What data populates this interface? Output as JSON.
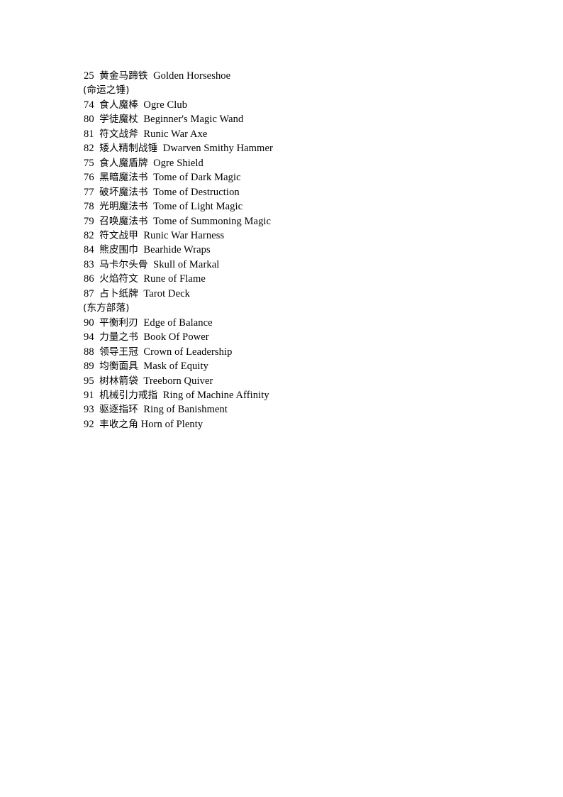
{
  "document": {
    "page_background": "#ffffff",
    "text_color": "#000000",
    "lines": [
      {
        "kind": "entry",
        "id": "25",
        "cn": "黄金马蹄铁",
        "en": "Golden Horseshoe",
        "gap": "wide"
      },
      {
        "kind": "section",
        "text": "(命运之锤)"
      },
      {
        "kind": "entry",
        "id": "74",
        "cn": "食人魔棒",
        "en": "Ogre Club",
        "gap": "wide"
      },
      {
        "kind": "entry",
        "id": "80",
        "cn": "学徒魔杖",
        "en": "Beginner's Magic Wand",
        "gap": "wide"
      },
      {
        "kind": "entry",
        "id": "81",
        "cn": "符文战斧",
        "en": "Runic War Axe",
        "gap": "wide"
      },
      {
        "kind": "entry",
        "id": "82",
        "cn": "矮人精制战锤",
        "en": "Dwarven Smithy Hammer",
        "gap": "wide"
      },
      {
        "kind": "entry",
        "id": "75",
        "cn": "食人魔盾牌",
        "en": "Ogre Shield",
        "gap": "wide"
      },
      {
        "kind": "entry",
        "id": "76",
        "cn": "黑暗魔法书",
        "en": "Tome of Dark Magic",
        "gap": "wide"
      },
      {
        "kind": "entry",
        "id": "77",
        "cn": "破坏魔法书",
        "en": "Tome of Destruction",
        "gap": "wide"
      },
      {
        "kind": "entry",
        "id": "78",
        "cn": "光明魔法书",
        "en": "Tome of Light Magic",
        "gap": "wide"
      },
      {
        "kind": "entry",
        "id": "79",
        "cn": "召唤魔法书",
        "en": "Tome of Summoning Magic",
        "gap": "wide"
      },
      {
        "kind": "entry",
        "id": "82",
        "cn": "符文战甲",
        "en": "Runic War Harness",
        "gap": "wide"
      },
      {
        "kind": "entry",
        "id": "84",
        "cn": "熊皮围巾",
        "en": "Bearhide Wraps",
        "gap": "wide"
      },
      {
        "kind": "entry",
        "id": "83",
        "cn": "马卡尔头骨",
        "en": "Skull of Markal",
        "gap": "wide"
      },
      {
        "kind": "entry",
        "id": "86",
        "cn": "火焰符文",
        "en": "Rune of Flame",
        "gap": "wide"
      },
      {
        "kind": "entry",
        "id": "87",
        "cn": "占卜纸牌",
        "en": "Tarot Deck",
        "gap": "wide"
      },
      {
        "kind": "section",
        "text": "(东方部落)"
      },
      {
        "kind": "entry",
        "id": "90",
        "cn": "平衡利刃",
        "en": "Edge of Balance",
        "gap": "wide"
      },
      {
        "kind": "entry",
        "id": "94",
        "cn": "力量之书",
        "en": "Book Of Power",
        "gap": "wide"
      },
      {
        "kind": "entry",
        "id": "88",
        "cn": "领导王冠",
        "en": "Crown of Leadership",
        "gap": "wide"
      },
      {
        "kind": "entry",
        "id": "89",
        "cn": "均衡面具",
        "en": "Mask of Equity",
        "gap": "wide"
      },
      {
        "kind": "entry",
        "id": "95",
        "cn": "树林箭袋",
        "en": "Treeborn Quiver",
        "gap": "wide"
      },
      {
        "kind": "entry",
        "id": "91",
        "cn": "机械引力戒指",
        "en": "Ring of Machine Affinity",
        "gap": "wide"
      },
      {
        "kind": "entry",
        "id": "93",
        "cn": "驱逐指环",
        "en": "Ring of Banishment",
        "gap": "wide"
      },
      {
        "kind": "entry",
        "id": "92",
        "cn": "丰收之角",
        "en": "Horn of Plenty",
        "gap": "narrow"
      }
    ]
  }
}
